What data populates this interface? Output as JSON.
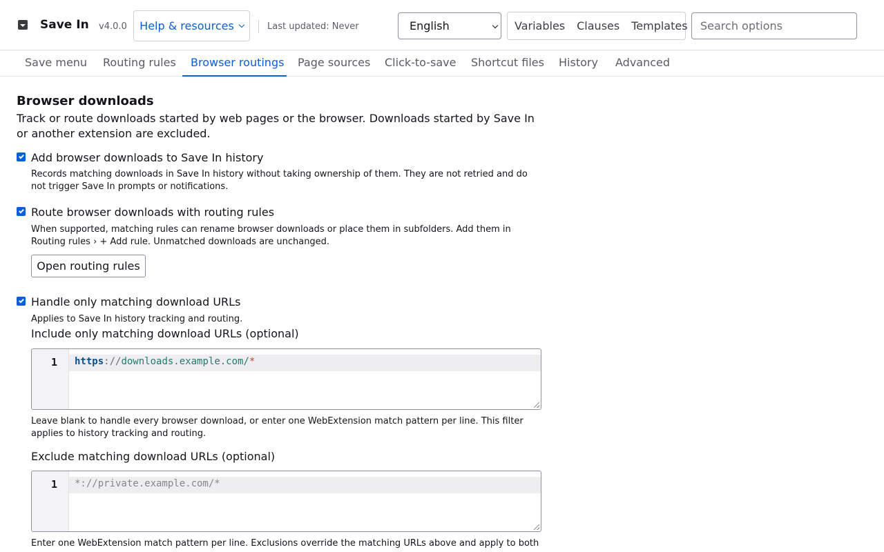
{
  "header": {
    "app_name": "Save In",
    "version": "v4.0.0",
    "help_label": "Help & resources",
    "last_updated": "Last updated: Never",
    "language": "English",
    "token_buttons": [
      "Variables",
      "Clauses",
      "Templates"
    ],
    "search_placeholder": "Search options"
  },
  "tabs": [
    {
      "label": "Save menu"
    },
    {
      "label": "Routing rules"
    },
    {
      "label": "Browser routings",
      "active": true
    },
    {
      "label": "Page sources"
    },
    {
      "label": "Click-to-save"
    },
    {
      "label": "Shortcut files"
    },
    {
      "label": "History"
    },
    {
      "label": "Advanced"
    }
  ],
  "section": {
    "title": "Browser downloads",
    "description": "Track or route downloads started by web pages or the browser. Downloads started by Save In or another extension are excluded."
  },
  "options": {
    "history": {
      "label": "Add browser downloads to Save In history",
      "checked": true,
      "help": "Records matching downloads in Save In history without taking ownership of them. They are not retried and do not trigger Save In prompts or notifications."
    },
    "routing": {
      "label": "Route browser downloads with routing rules",
      "checked": true,
      "help": "When supported, matching rules can rename browser downloads or place them in subfolders. Add them in Routing rules › + Add rule. Unmatched downloads are unchanged.",
      "button": "Open routing rules"
    },
    "matching": {
      "label": "Handle only matching download URLs",
      "checked": true,
      "help": "Applies to Save In history tracking and routing."
    }
  },
  "include": {
    "label": "Include only matching download URLs (optional)",
    "line_number": "1",
    "code": {
      "scheme": "https",
      "sep": "://",
      "host": "downloads.example.com/",
      "wild": "*"
    },
    "help": "Leave blank to handle every browser download, or enter one WebExtension match pattern per line. This filter applies to history tracking and routing."
  },
  "exclude": {
    "label": "Exclude matching download URLs (optional)",
    "line_number": "1",
    "placeholder": "*://private.example.com/*",
    "help": "Enter one WebExtension match pattern per line. Exclusions override the matching URLs above and apply to both"
  }
}
